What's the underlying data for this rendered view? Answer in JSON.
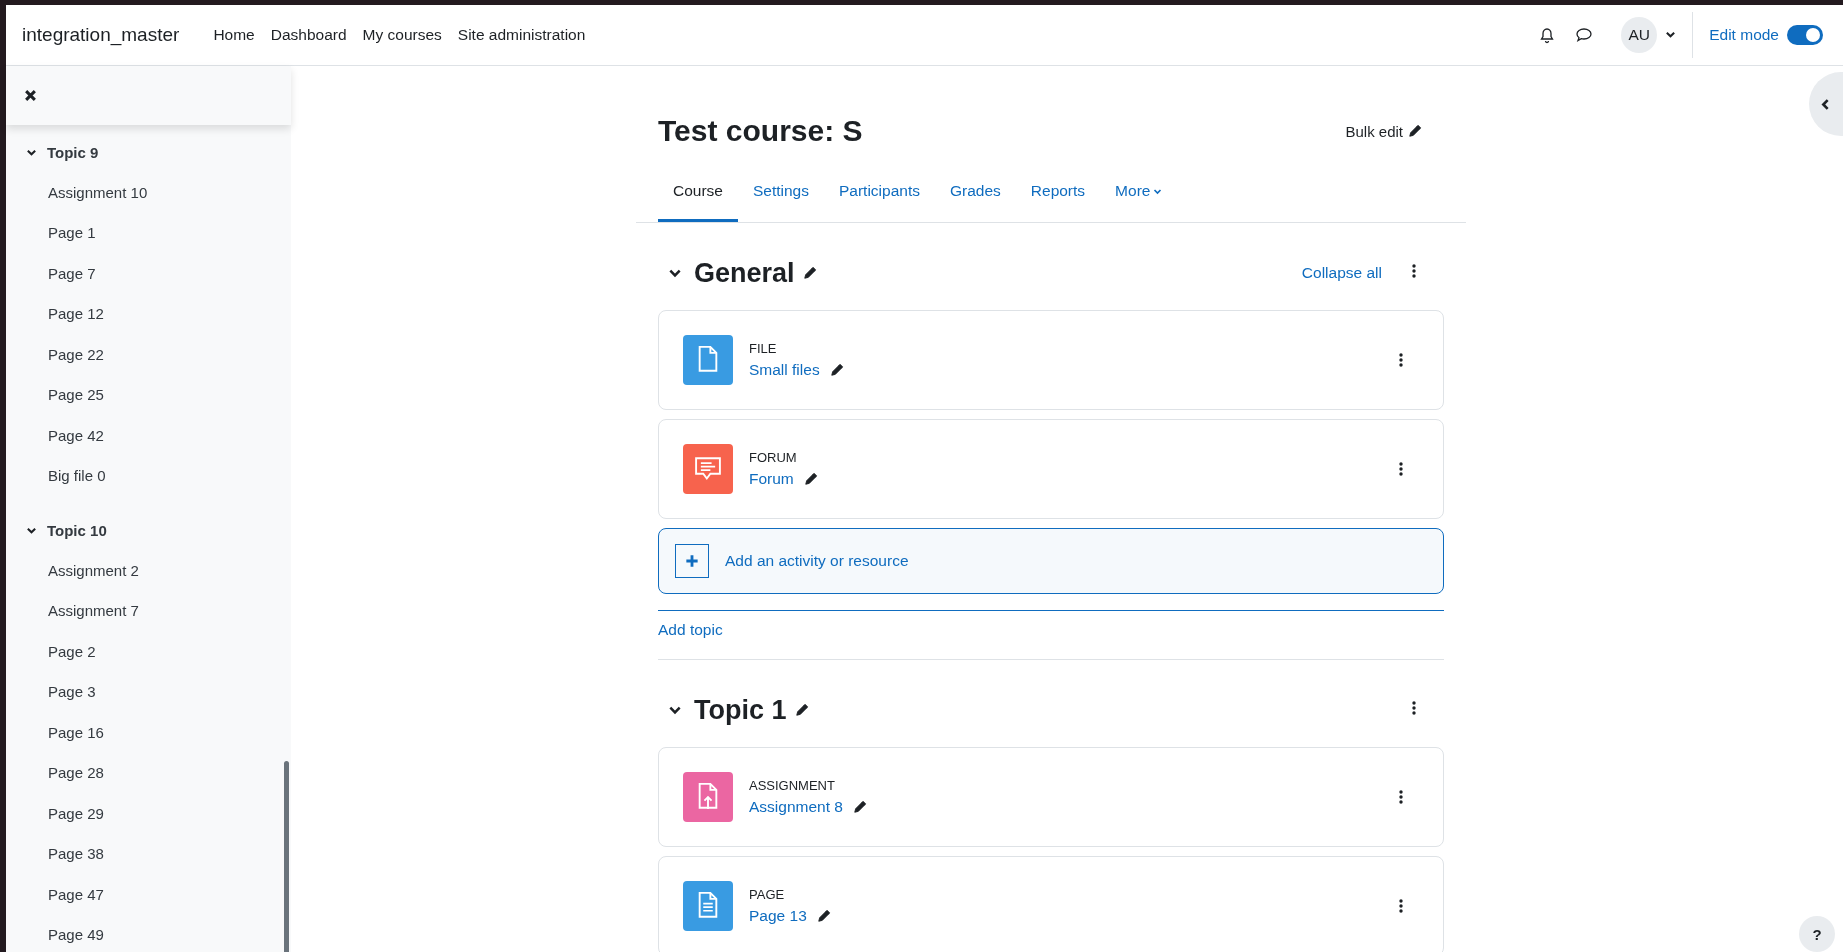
{
  "site_name": "integration_master",
  "nav": [
    {
      "label": "Home"
    },
    {
      "label": "Dashboard"
    },
    {
      "label": "My courses"
    },
    {
      "label": "Site administration"
    }
  ],
  "user": {
    "initials": "AU"
  },
  "edit_mode": {
    "label": "Edit mode",
    "on": true
  },
  "sidebar": {
    "sections": [
      {
        "title": "Topic 9",
        "expanded": true,
        "items": [
          "Assignment 10",
          "Page 1",
          "Page 7",
          "Page 12",
          "Page 22",
          "Page 25",
          "Page 42",
          "Big file 0"
        ]
      },
      {
        "title": "Topic 10",
        "expanded": true,
        "items": [
          "Assignment 2",
          "Assignment 7",
          "Page 2",
          "Page 3",
          "Page 16",
          "Page 28",
          "Page 29",
          "Page 38",
          "Page 47",
          "Page 49"
        ]
      }
    ]
  },
  "course": {
    "title": "Test course: S",
    "bulk_edit": "Bulk edit",
    "tabs": [
      {
        "label": "Course",
        "selected": true
      },
      {
        "label": "Settings",
        "selected": false
      },
      {
        "label": "Participants",
        "selected": false
      },
      {
        "label": "Grades",
        "selected": false
      },
      {
        "label": "Reports",
        "selected": false
      },
      {
        "label": "More",
        "selected": false
      }
    ],
    "sections": [
      {
        "title": "General",
        "expanded": true,
        "collapse_all": "Collapse all",
        "activities": [
          {
            "kind": "file",
            "type_label": "FILE",
            "name": "Small files"
          },
          {
            "kind": "forum",
            "type_label": "FORUM",
            "name": "Forum"
          }
        ],
        "add_activity": "Add an activity or resource",
        "add_topic": "Add topic"
      },
      {
        "title": "Topic 1",
        "expanded": true,
        "activities": [
          {
            "kind": "assignment",
            "type_label": "ASSIGNMENT",
            "name": "Assignment 8"
          },
          {
            "kind": "page",
            "type_label": "PAGE",
            "name": "Page 13"
          }
        ]
      }
    ]
  },
  "help_button": "?"
}
